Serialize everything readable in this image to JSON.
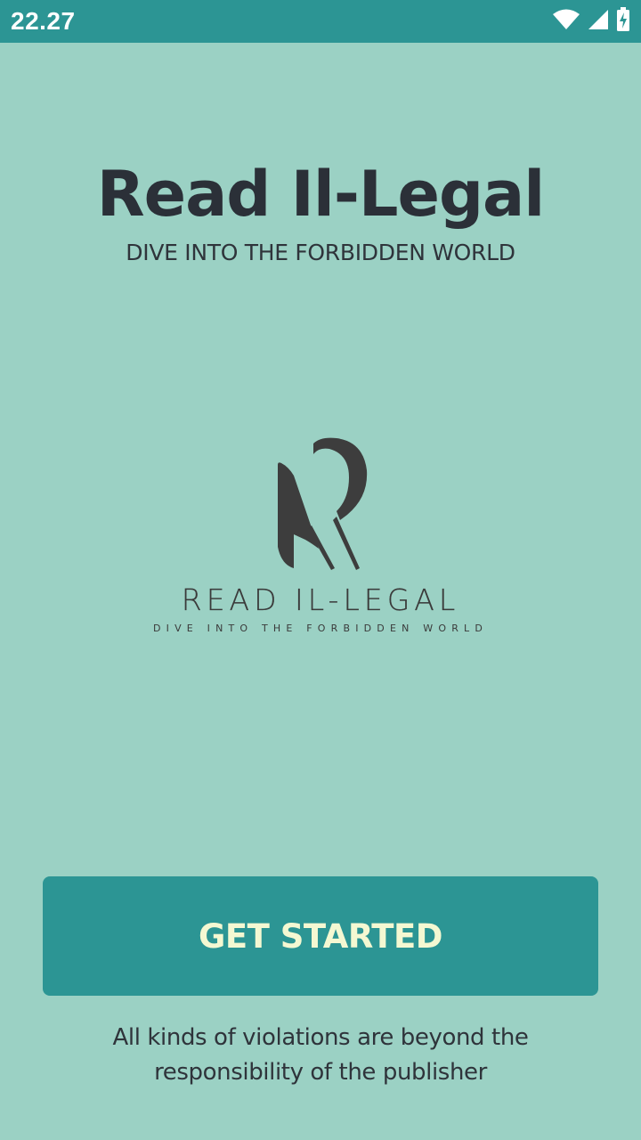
{
  "status_bar": {
    "time": "22.27",
    "icons": [
      "wifi-icon",
      "cellular-signal-icon",
      "battery-charging-icon"
    ]
  },
  "header": {
    "title": "Read Il-Legal",
    "subtitle": "DIVE INTO THE FORBIDDEN WORLD"
  },
  "logo": {
    "wordmark": "READ IL-LEGAL",
    "tagline": "DIVE INTO THE FORBIDDEN WORLD"
  },
  "actions": {
    "get_started_label": "GET STARTED"
  },
  "footer": {
    "disclaimer": "All kinds of violations are beyond the responsibility of the publisher"
  },
  "colors": {
    "background": "#9bd1c4",
    "accent": "#2c9594",
    "button_text": "#f4f8d2",
    "text_dark": "#2b3038",
    "logo": "#3a3a3a"
  }
}
